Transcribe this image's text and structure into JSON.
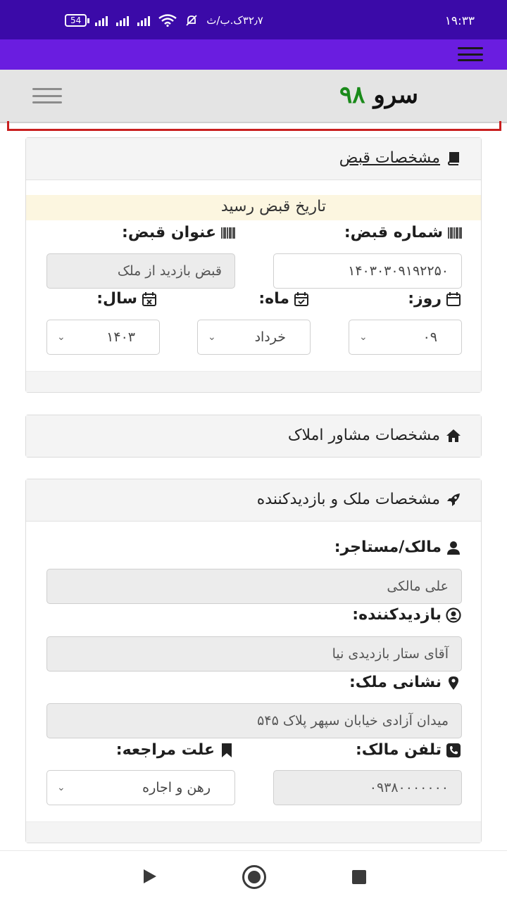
{
  "status_bar": {
    "time": "۱۹:۳۳",
    "network_speed": "۳۲٫۷ک.ب/ث",
    "battery": "54",
    "icons": [
      "signal-icon",
      "signal-icon",
      "signal-icon",
      "wifi-icon",
      "mute-icon"
    ]
  },
  "header": {
    "logo_text": "سرو",
    "logo_number": "۹۸",
    "logo_number_color": "#1a8a1a",
    "accent_purple": "#6a1de0"
  },
  "receipt_panel": {
    "title": "مشخصات قبض",
    "banner": "تاریخ قبض رسید",
    "receipt_number_label": "شماره قبض:",
    "receipt_number_value": "۱۴۰۳۰۳۰۹۱۹۲۲۵۰",
    "receipt_title_label": "عنوان قبض:",
    "receipt_title_value": "قبض بازدید از ملک",
    "day_label": "روز:",
    "day_value": "۰۹",
    "month_label": "ماه:",
    "month_value": "خرداد",
    "year_label": "سال:",
    "year_value": "۱۴۰۳"
  },
  "advisor_panel": {
    "title": "مشخصات مشاور املاک"
  },
  "property_panel": {
    "title": "مشخصات ملک و بازدیدکننده",
    "owner_label": "مالک/مستاجر:",
    "owner_value": "علی مالکی",
    "visitor_label": "بازدیدکننده:",
    "visitor_value": "آقای ستار بازدیدی نیا",
    "address_label": "نشانی ملک:",
    "address_value": "میدان آزادی خیابان سپهر پلاک ۵۴۵",
    "phone_label": "تلفن مالک:",
    "phone_value": "۰۹۳۸۰۰۰۰۰۰۰",
    "reason_label": "علت مراجعه:",
    "reason_value": "رهن و اجاره"
  }
}
